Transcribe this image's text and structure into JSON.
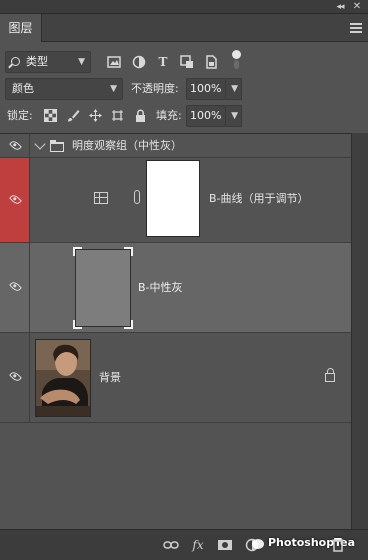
{
  "panel": {
    "tab_label": "图层",
    "collapse_glyph": "◂◂",
    "close_glyph": "✕"
  },
  "filter": {
    "kind_label": "类型",
    "icons": [
      "pixel-filter-icon",
      "adjustment-filter-icon",
      "type-filter-icon",
      "shape-filter-icon",
      "smart-object-filter-icon",
      "filter-toggle-icon"
    ]
  },
  "blend": {
    "mode": "颜色",
    "opacity_label": "不透明度:",
    "opacity_value": "100%"
  },
  "lock": {
    "label": "锁定:",
    "fill_label": "填充:",
    "fill_value": "100%",
    "icons": [
      "lock-transparent-icon",
      "lock-paint-icon",
      "lock-position-icon",
      "lock-artboard-icon",
      "lock-all-icon"
    ]
  },
  "layers": {
    "group": {
      "name": "明度观察组（中性灰）",
      "expanded": true
    },
    "curves": {
      "name": "B-曲线（用于调节）",
      "visibility_highlight": "#bf3f3f"
    },
    "gray": {
      "name": "B-中性灰",
      "selected": true
    },
    "background": {
      "name": "背景",
      "locked": true
    }
  },
  "footer": {
    "icons": [
      "link-layers-icon",
      "fx-icon",
      "add-mask-icon",
      "new-adjustment-icon",
      "new-group-icon",
      "new-layer-icon",
      "delete-layer-icon"
    ],
    "fx_label": "fx",
    "watermark": "PhotoshopTea"
  },
  "colors": {
    "panel_bg": "#535353",
    "selected_row": "#666666",
    "visibility_red": "#bf3f3f"
  }
}
